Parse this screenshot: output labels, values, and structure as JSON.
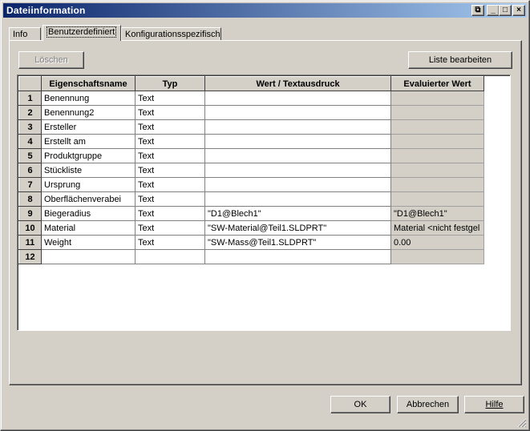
{
  "window": {
    "title": "Dateiinformation",
    "buttons": {
      "restore": "⧉",
      "minimize": "_",
      "maximize": "□",
      "close": "×"
    }
  },
  "tabs": [
    {
      "label": "Info",
      "active": false
    },
    {
      "label": "Benutzerdefiniert",
      "active": true
    },
    {
      "label": "Konfigurationsspezifisch",
      "active": false
    }
  ],
  "toolbar": {
    "delete_label": "Löschen",
    "edit_list_label": "Liste bearbeiten"
  },
  "table": {
    "headers": [
      "",
      "Eigenschaftsname",
      "Typ",
      "Wert / Textausdruck",
      "Evaluierter Wert"
    ],
    "rows": [
      {
        "num": "1",
        "name": "Benennung",
        "type": "Text",
        "value": "",
        "evaluated": ""
      },
      {
        "num": "2",
        "name": "Benennung2",
        "type": "Text",
        "value": "",
        "evaluated": ""
      },
      {
        "num": "3",
        "name": "Ersteller",
        "type": "Text",
        "value": "",
        "evaluated": ""
      },
      {
        "num": "4",
        "name": "Erstellt am",
        "type": "Text",
        "value": "",
        "evaluated": ""
      },
      {
        "num": "5",
        "name": "Produktgruppe",
        "type": "Text",
        "value": "",
        "evaluated": ""
      },
      {
        "num": "6",
        "name": "Stückliste",
        "type": "Text",
        "value": "",
        "evaluated": ""
      },
      {
        "num": "7",
        "name": "Ursprung",
        "type": "Text",
        "value": "",
        "evaluated": ""
      },
      {
        "num": "8",
        "name": "Oberflächenverabei",
        "type": "Text",
        "value": "",
        "evaluated": ""
      },
      {
        "num": "9",
        "name": "Biegeradius",
        "type": "Text",
        "value": "\"D1@Blech1\"",
        "evaluated": "\"D1@Blech1\""
      },
      {
        "num": "10",
        "name": "Material",
        "type": "Text",
        "value": "\"SW-Material@Teil1.SLDPRT\"",
        "evaluated": "Material <nicht festgel"
      },
      {
        "num": "11",
        "name": "Weight",
        "type": "Text",
        "value": "\"SW-Mass@Teil1.SLDPRT\"",
        "evaluated": "0.00"
      },
      {
        "num": "12",
        "name": "",
        "type": "",
        "value": "",
        "evaluated": ""
      }
    ]
  },
  "footer": {
    "ok_label": "OK",
    "cancel_label": "Abbrechen",
    "help_label": "Hilfe"
  }
}
